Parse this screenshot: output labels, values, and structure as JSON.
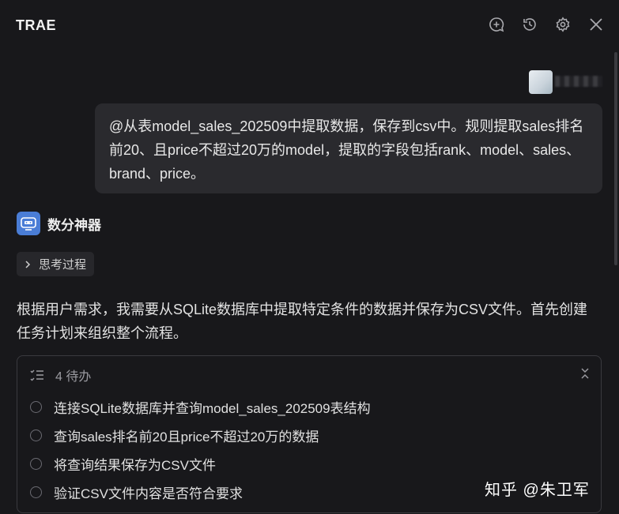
{
  "header": {
    "title": "TRAE",
    "icons": [
      "new-chat-icon",
      "history-icon",
      "settings-icon",
      "close-icon"
    ]
  },
  "user_message": {
    "text": "@从表model_sales_202509中提取数据，保存到csv中。规则提取sales排名前20、且price不超过20万的model，提取的字段包括rank、model、sales、brand、price。"
  },
  "assistant": {
    "name": "数分神器",
    "thinking_label": "思考过程",
    "response": "根据用户需求，我需要从SQLite数据库中提取特定条件的数据并保存为CSV文件。首先创建任务计划来组织整个流程。"
  },
  "todo": {
    "header": "4 待办",
    "items": [
      {
        "label": "连接SQLite数据库并查询model_sales_202509表结构"
      },
      {
        "label": "查询sales排名前20且price不超过20万的数据"
      },
      {
        "label": "将查询结果保存为CSV文件"
      },
      {
        "label": "验证CSV文件内容是否符合要求"
      }
    ]
  },
  "watermark": "知乎 @朱卫军",
  "colors": {
    "background": "#18181b",
    "bubble": "#2a2a2e",
    "accent": "#4a7dd6"
  }
}
